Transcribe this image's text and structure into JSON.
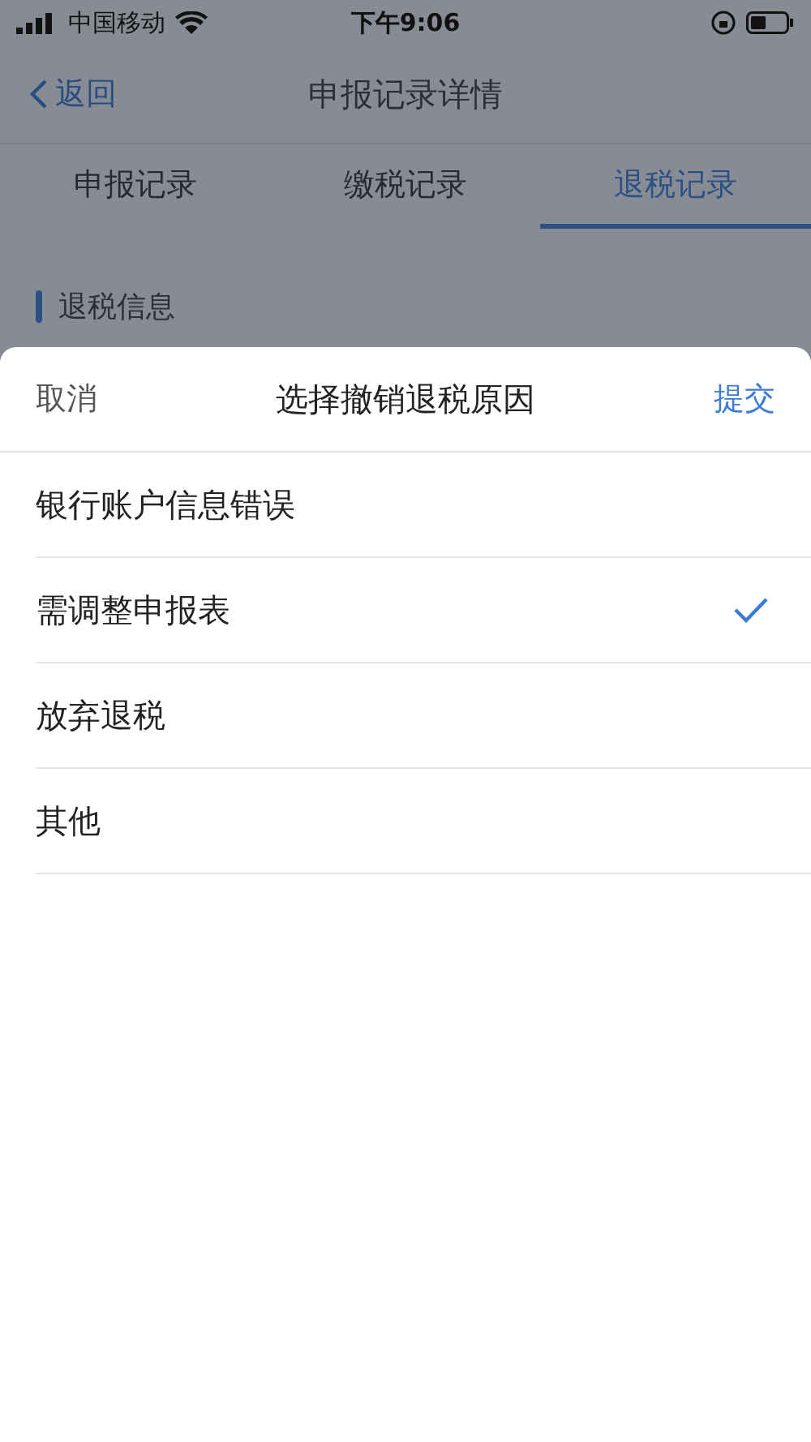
{
  "status_bar": {
    "carrier": "中国移动",
    "time": "下午9:06"
  },
  "nav": {
    "back": "返回",
    "title": "申报记录详情"
  },
  "tabs": [
    {
      "label": "申报记录",
      "selected": false
    },
    {
      "label": "缴税记录",
      "selected": false
    },
    {
      "label": "退税记录",
      "selected": true
    }
  ],
  "section": {
    "title": "退税信息"
  },
  "sheet": {
    "cancel": "取消",
    "title": "选择撤销退税原因",
    "submit": "提交",
    "options": [
      {
        "label": "银行账户信息错误",
        "selected": false
      },
      {
        "label": "需调整申报表",
        "selected": true
      },
      {
        "label": "放弃退税",
        "selected": false
      },
      {
        "label": "其他",
        "selected": false
      }
    ]
  }
}
